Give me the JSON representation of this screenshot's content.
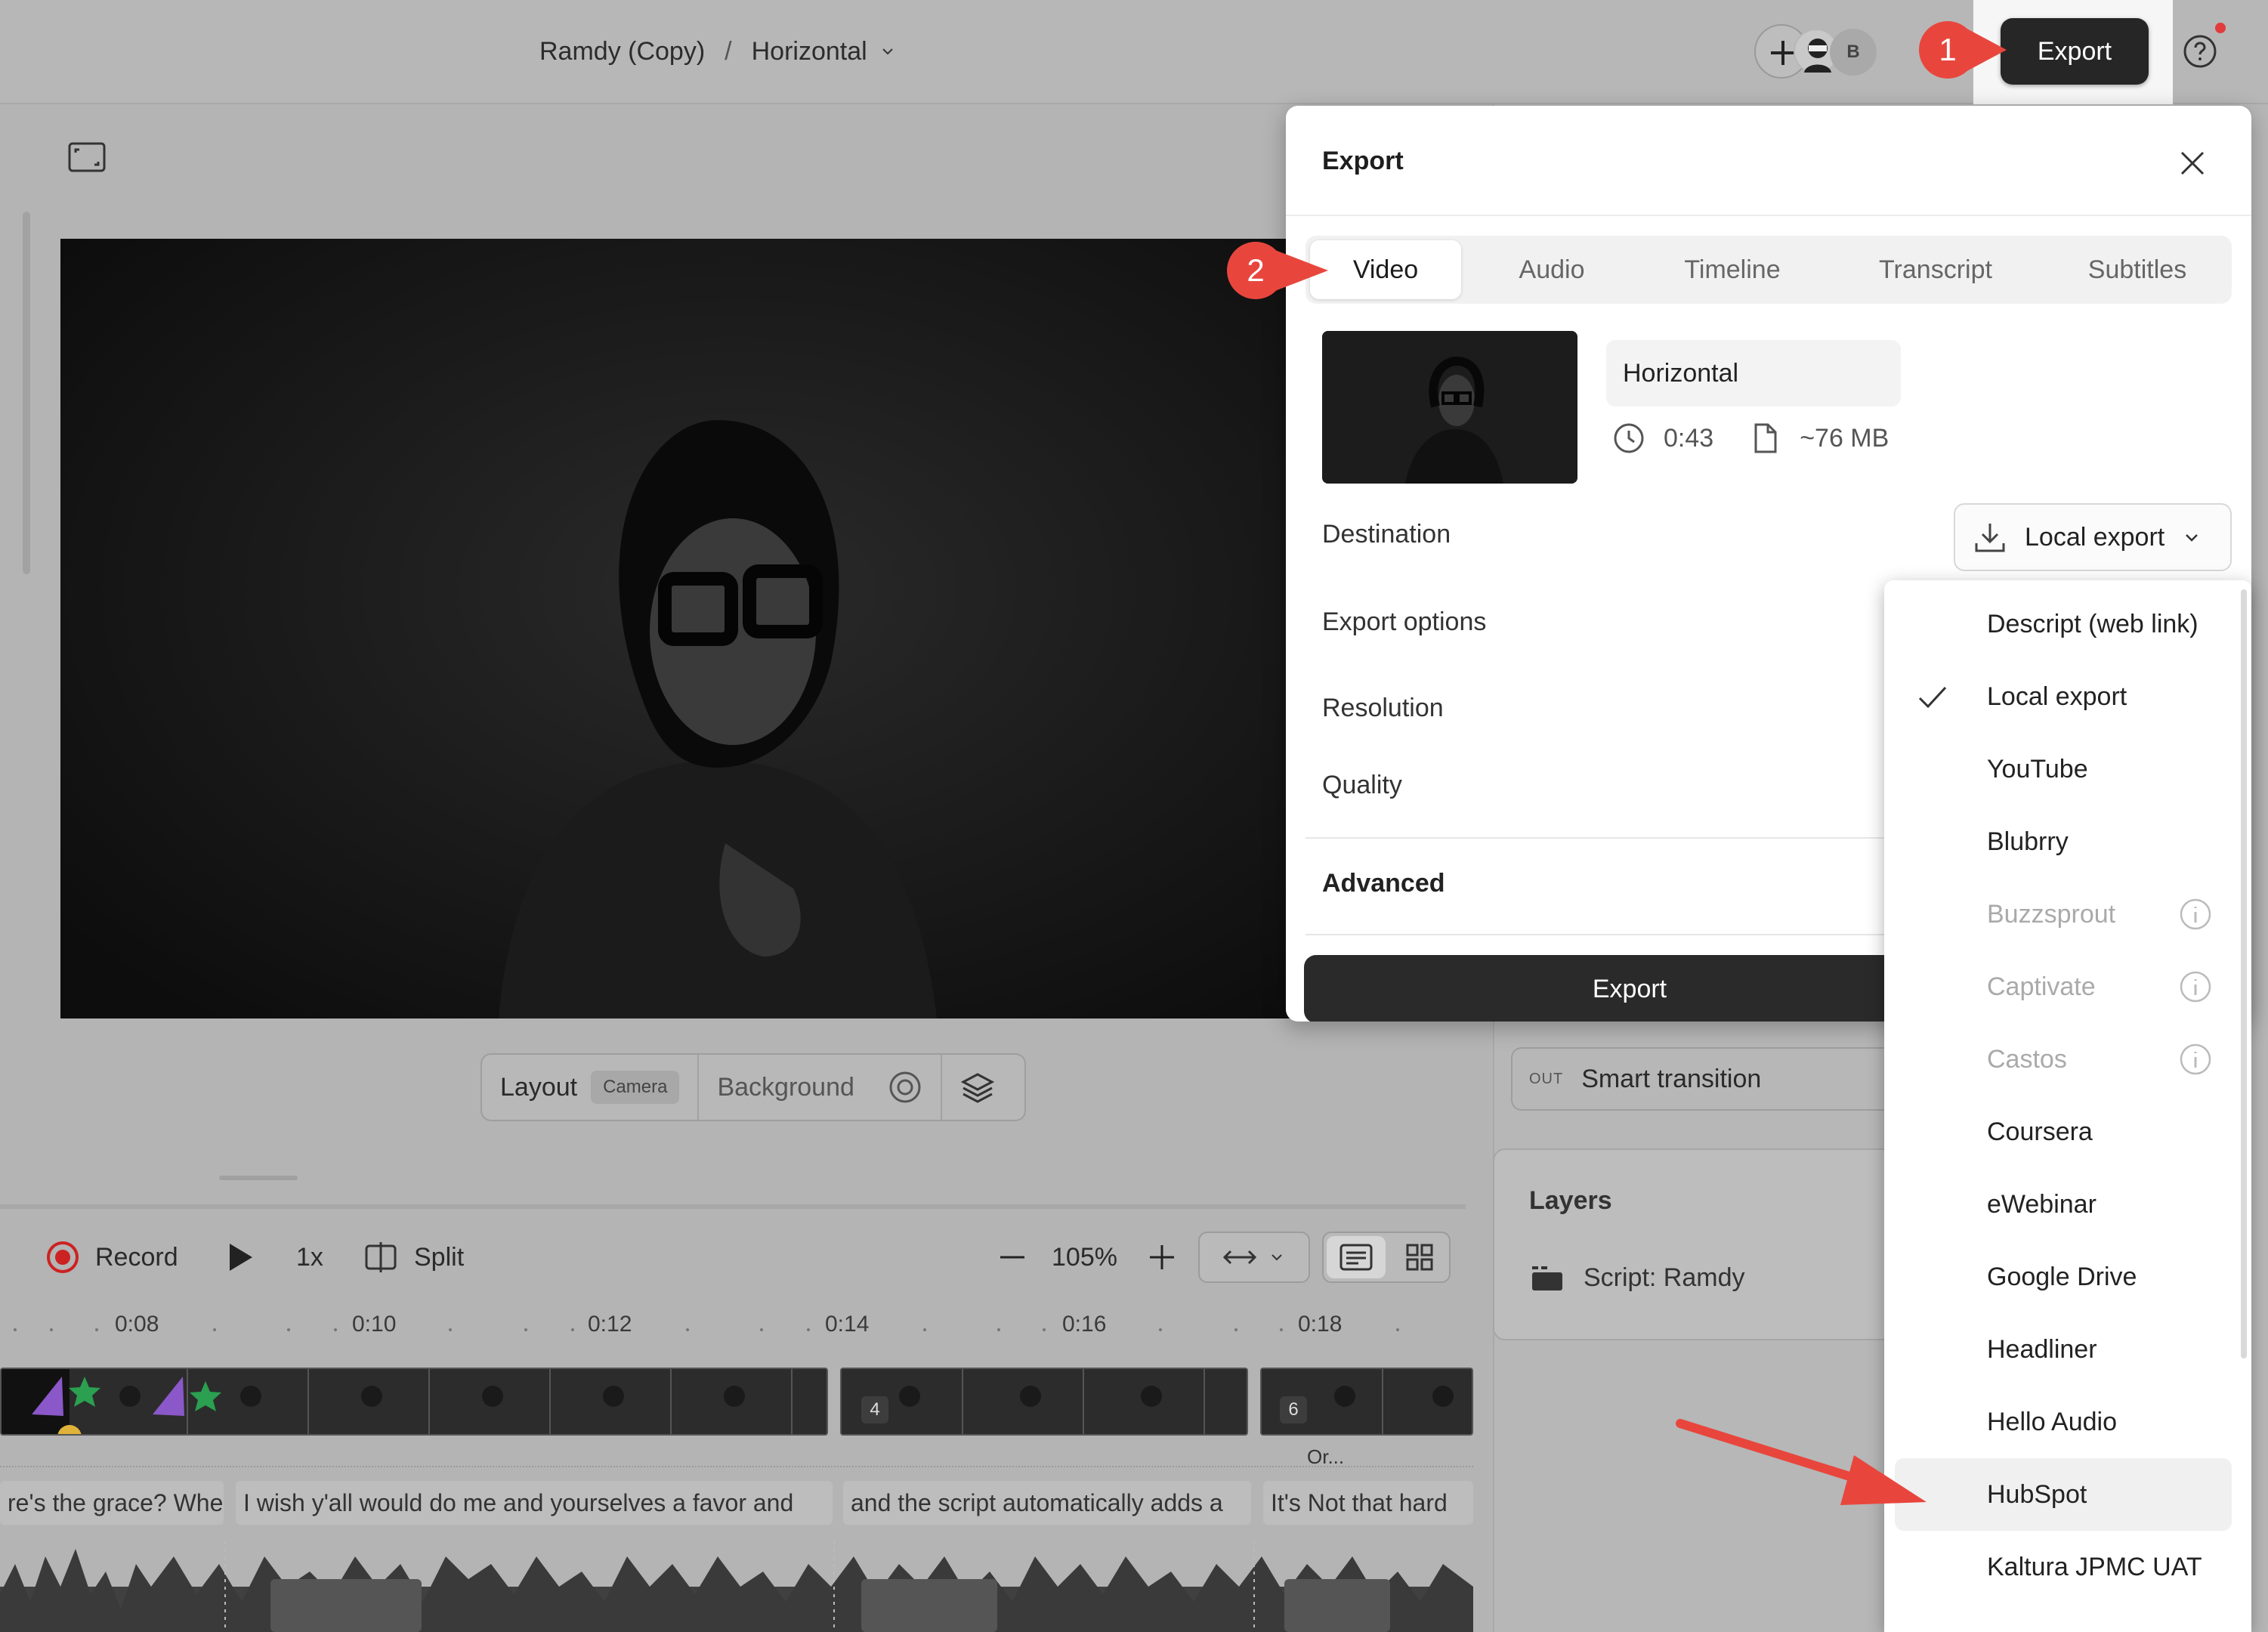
{
  "header": {
    "project": "Ramdy (Copy)",
    "separator": "/",
    "composition": "Horizontal",
    "avatar_initial": "B",
    "export_label": "Export"
  },
  "steps": {
    "one": "1",
    "two": "2"
  },
  "editor": {
    "layout_label": "Layout",
    "layout_value": "Camera",
    "background_label": "Background"
  },
  "transport": {
    "record": "Record",
    "speed": "1x",
    "split": "Split",
    "zoom": "105%"
  },
  "timeline": {
    "ticks": [
      "0:08",
      "0:10",
      "0:12",
      "0:14",
      "0:16",
      "0:18"
    ],
    "clip_numbers": [
      "4",
      "6"
    ],
    "scenes": [
      "re's the grace? Whe",
      "I wish y'all would do me and yourselves a favor and",
      "and the script automatically adds a",
      "It's Not that hard"
    ],
    "overflow_label": "Or..."
  },
  "sidebar": {
    "out_label": "OUT",
    "transition": "Smart transition",
    "layers_title": "Layers",
    "layer_item": "Script: Ramdy"
  },
  "export_panel": {
    "title": "Export",
    "tabs": [
      "Video",
      "Audio",
      "Timeline",
      "Transcript",
      "Subtitles"
    ],
    "active_tab": "Video",
    "composition_name": "Horizontal",
    "duration": "0:43",
    "size": "~76 MB",
    "rows": {
      "destination": "Destination",
      "export_options": "Export options",
      "resolution": "Resolution",
      "quality": "Quality",
      "advanced": "Advanced"
    },
    "destination_value": "Local export",
    "export_button": "Export"
  },
  "destinations": [
    {
      "label": "Descript (web link)",
      "disabled": false
    },
    {
      "label": "Local export",
      "selected": true
    },
    {
      "label": "YouTube"
    },
    {
      "label": "Blubrry"
    },
    {
      "label": "Buzzsprout",
      "disabled": true
    },
    {
      "label": "Captivate",
      "disabled": true
    },
    {
      "label": "Castos",
      "disabled": true
    },
    {
      "label": "Coursera"
    },
    {
      "label": "eWebinar"
    },
    {
      "label": "Google Drive"
    },
    {
      "label": "Headliner"
    },
    {
      "label": "Hello Audio"
    },
    {
      "label": "HubSpot",
      "highlighted": true
    },
    {
      "label": "Kaltura JPMC UAT"
    }
  ],
  "colors": {
    "accent_red": "#e8463d",
    "dark_button": "#2a2a2a",
    "record_red": "#cc2222"
  }
}
